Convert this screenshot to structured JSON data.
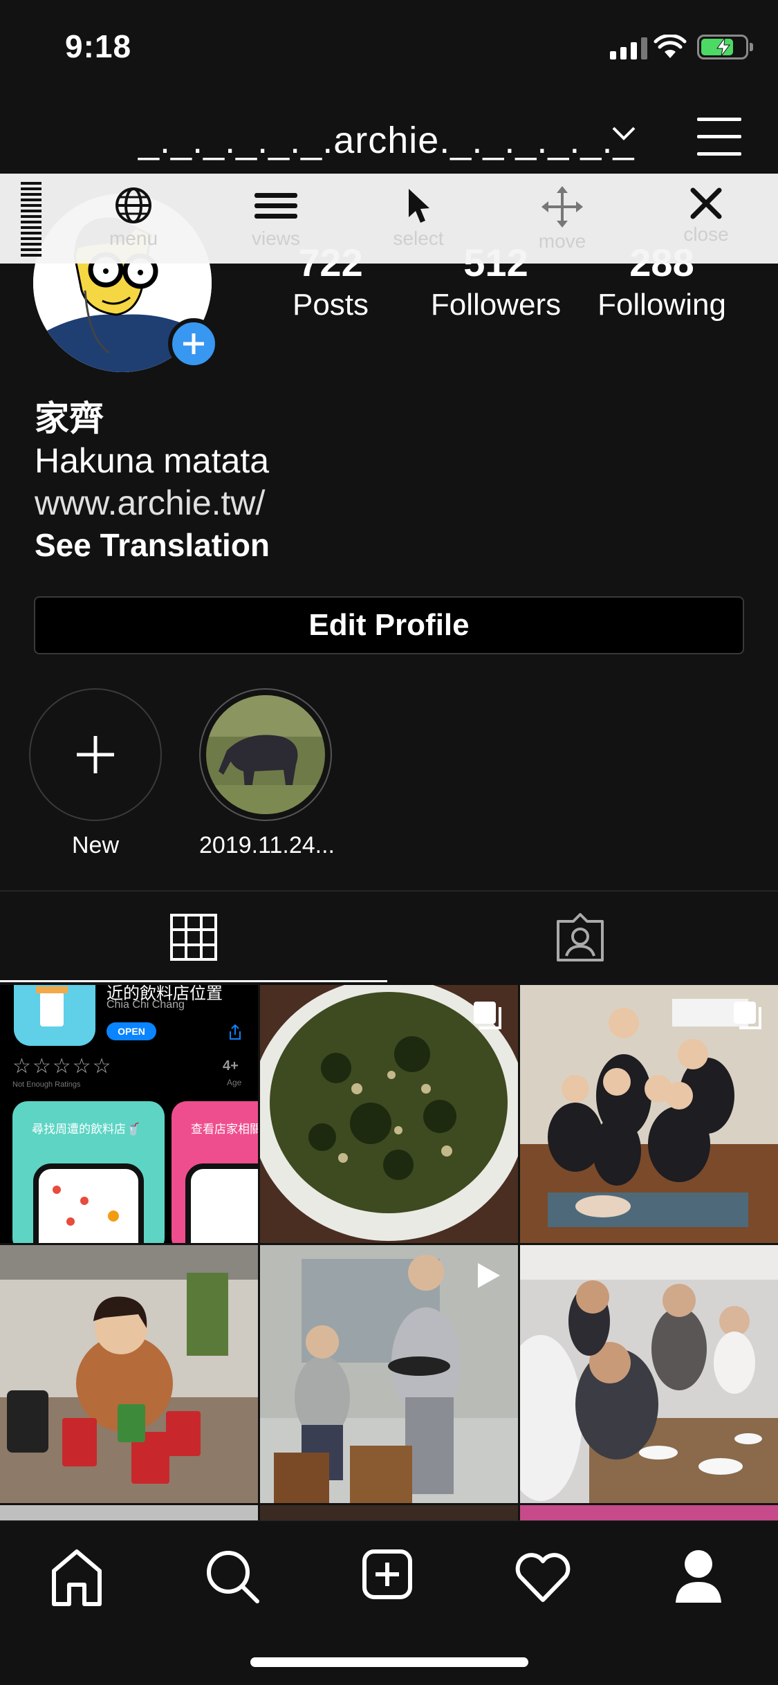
{
  "status": {
    "time": "9:18"
  },
  "header": {
    "username": "_._._._._._.archie._._._._._._"
  },
  "toolbar": {
    "items": [
      {
        "label": "menu",
        "icon": "globe-icon"
      },
      {
        "label": "views",
        "icon": "list-icon"
      },
      {
        "label": "select",
        "icon": "cursor-icon"
      },
      {
        "label": "move",
        "icon": "move-icon"
      },
      {
        "label": "close",
        "icon": "close-icon"
      }
    ]
  },
  "profile": {
    "stats": [
      {
        "num": "722",
        "label": "Posts"
      },
      {
        "num": "512",
        "label": "Followers"
      },
      {
        "num": "288",
        "label": "Following"
      }
    ],
    "name": "家齊",
    "bio": "Hakuna matata",
    "link": "www.archie.tw/",
    "see_translation": "See Translation",
    "edit_button": "Edit Profile"
  },
  "highlights": [
    {
      "label": "New"
    },
    {
      "label": "2019.11.24..."
    }
  ],
  "tabs": [
    {
      "icon": "grid-icon",
      "active": true
    },
    {
      "icon": "tagged-icon",
      "active": false
    }
  ],
  "posts": {
    "app_card": {
      "title": "近的飲料店位置",
      "developer": "Chia Chi Chang",
      "open_label": "OPEN",
      "ratings_label": "Not Enough Ratings",
      "age": "4+",
      "age_label": "Age",
      "banner1": "尋找周遭的飲料店🥤",
      "banner2": "查看店家相關"
    }
  },
  "colors": {
    "accent": "#3897f0",
    "background": "#121212",
    "battery": "#4cd964"
  }
}
